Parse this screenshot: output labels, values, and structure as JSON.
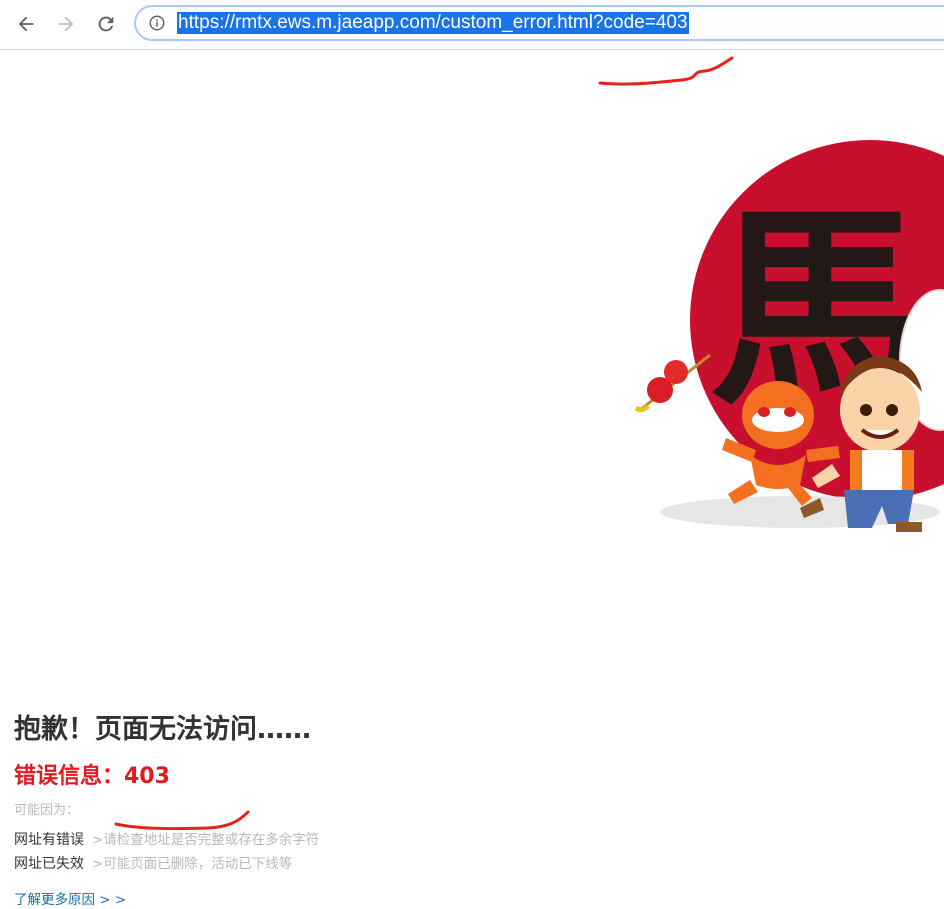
{
  "browser": {
    "url": "https://rmtx.ews.m.jaeapp.com/custom_error.html?code=403",
    "back_icon": "arrow-left-icon",
    "forward_icon": "arrow-right-icon",
    "reload_icon": "reload-icon",
    "info_icon": "info-icon"
  },
  "illustration": {
    "glyph": "馬",
    "circle_color": "#c8102e"
  },
  "error": {
    "heading": "抱歉！页面无法访问……",
    "code_line": "错误信息：403",
    "reasons_title": "可能因为：",
    "reasons": [
      {
        "label": "网址有错误",
        "detail": ">请检查地址是否完整或存在多余字符"
      },
      {
        "label": "网址已失效",
        "detail": ">可能页面已删除，活动已下线等"
      }
    ],
    "more_link": "了解更多原因 > >"
  },
  "colors": {
    "error_red": "#e4181e",
    "link_blue": "#1a6fa8",
    "selection_blue": "#1a73e8"
  }
}
